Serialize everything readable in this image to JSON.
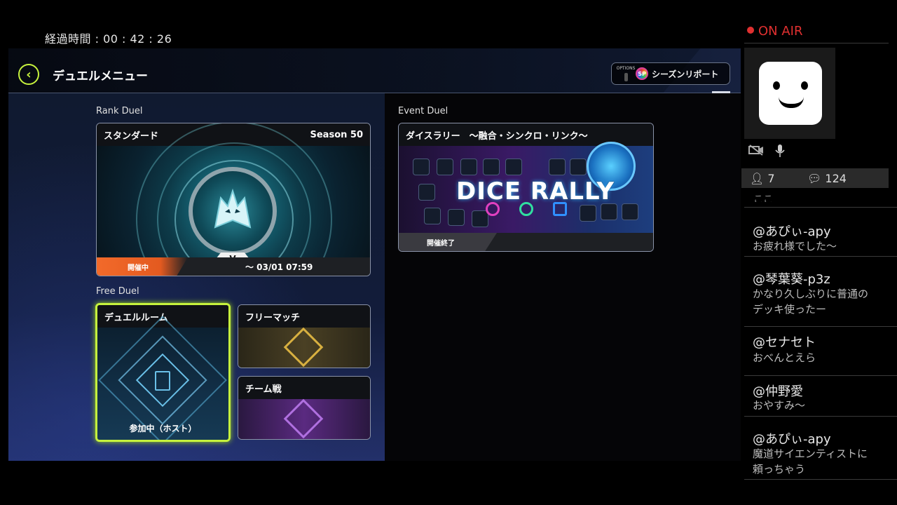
{
  "elapsed_time": "経過時間 : 00 : 42 : 26",
  "header": {
    "title": "デュエルメニュー",
    "options_label": "OPTIONS",
    "sp_badge": "SP",
    "season_report_label": "シーズンリポート"
  },
  "rank_duel": {
    "section_label": "Rank Duel",
    "mode": "スタンダード",
    "season": "Season 50",
    "rank_letter": "V",
    "status": "開催中",
    "period": "～ 03/01 07:59"
  },
  "event_duel": {
    "section_label": "Event Duel",
    "title": "ダイスラリー　～融合・シンクロ・リンク～",
    "logo_text": "DICE RALLY",
    "status": "開催終了"
  },
  "free_duel": {
    "section_label": "Free Duel",
    "duel_room": {
      "title": "デュエルルーム",
      "status": "参加中（ホスト）"
    },
    "free_match": {
      "title": "フリーマッチ"
    },
    "team_battle": {
      "title": "チーム戦"
    }
  },
  "stream": {
    "status": "ON AIR",
    "viewers": "7",
    "comments_count": "124",
    "cut_text": "ここ",
    "comments": [
      {
        "user": "@あぴぃ-apy",
        "text": "お疲れ様でした～"
      },
      {
        "user": "@琴葉葵-p3z",
        "text": "かなり久しぶりに普通のデッキ使ったー"
      },
      {
        "user": "@セナセト",
        "text": "おべんとえら"
      },
      {
        "user": "@仲野愛",
        "text": "おやすみ～"
      },
      {
        "user": "@あぴぃ-apy",
        "text": "魔道サイエンティストに頼っちゃう"
      }
    ]
  },
  "colors": {
    "accent_green": "#c6f23d",
    "onair_red": "#e03030",
    "live_orange": "#f26a2a"
  }
}
